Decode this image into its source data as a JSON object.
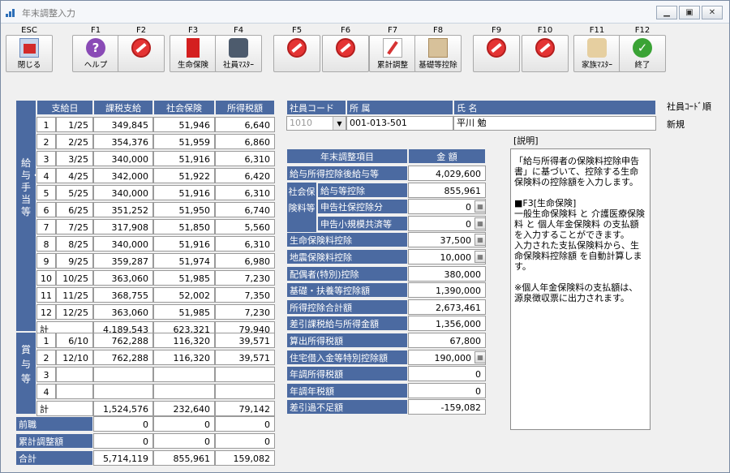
{
  "window": {
    "title": "年末調整入力"
  },
  "toolbar": [
    {
      "key": "ESC",
      "label": "閉じる",
      "icon": "exit-icon"
    },
    {
      "key": "F1",
      "label": "ヘルプ",
      "icon": "help-icon"
    },
    {
      "key": "F2",
      "label": "",
      "icon": "no-entry-icon"
    },
    {
      "key": "F3",
      "label": "生命保険",
      "icon": "life-insurance-icon"
    },
    {
      "key": "F4",
      "label": "社員ﾏｽﾀｰ",
      "icon": "employee-master-icon"
    },
    {
      "key": "F5",
      "label": "",
      "icon": "no-entry-icon"
    },
    {
      "key": "F6",
      "label": "",
      "icon": "no-entry-icon"
    },
    {
      "key": "F7",
      "label": "累計調整",
      "icon": "cumulative-adjust-icon"
    },
    {
      "key": "F8",
      "label": "基礎等控除",
      "icon": "basic-deduction-icon"
    },
    {
      "key": "F9",
      "label": "",
      "icon": "no-entry-icon"
    },
    {
      "key": "F10",
      "label": "",
      "icon": "no-entry-icon"
    },
    {
      "key": "F11",
      "label": "家族ﾏｽﾀｰ",
      "icon": "family-master-icon"
    },
    {
      "key": "F12",
      "label": "終了",
      "icon": "check-icon"
    }
  ],
  "salary": {
    "side_label": "給与・手当等",
    "headers": [
      "支給日",
      "課税支給",
      "社会保険",
      "所得税額"
    ],
    "rows": [
      [
        "1",
        "1/25",
        "349,845",
        "51,946",
        "6,640"
      ],
      [
        "2",
        "2/25",
        "354,376",
        "51,959",
        "6,860"
      ],
      [
        "3",
        "3/25",
        "340,000",
        "51,916",
        "6,310"
      ],
      [
        "4",
        "4/25",
        "342,000",
        "51,922",
        "6,420"
      ],
      [
        "5",
        "5/25",
        "340,000",
        "51,916",
        "6,310"
      ],
      [
        "6",
        "6/25",
        "351,252",
        "51,950",
        "6,740"
      ],
      [
        "7",
        "7/25",
        "317,908",
        "51,850",
        "5,560"
      ],
      [
        "8",
        "8/25",
        "340,000",
        "51,916",
        "6,310"
      ],
      [
        "9",
        "9/25",
        "359,287",
        "51,974",
        "6,980"
      ],
      [
        "10",
        "10/25",
        "363,060",
        "51,985",
        "7,230"
      ],
      [
        "11",
        "11/25",
        "368,755",
        "52,002",
        "7,350"
      ],
      [
        "12",
        "12/25",
        "363,060",
        "51,985",
        "7,230"
      ]
    ],
    "total": [
      "計",
      "4,189,543",
      "623,321",
      "79,940"
    ]
  },
  "bonus": {
    "side_label": "賞与等",
    "rows": [
      [
        "1",
        "6/10",
        "762,288",
        "116,320",
        "39,571"
      ],
      [
        "2",
        "12/10",
        "762,288",
        "116,320",
        "39,571"
      ],
      [
        "3",
        "",
        "",
        "",
        ""
      ],
      [
        "4",
        "",
        "",
        "",
        ""
      ]
    ],
    "total": [
      "計",
      "1,524,576",
      "232,640",
      "79,142"
    ]
  },
  "previous": {
    "label": "前職",
    "values": [
      "0",
      "0",
      "0"
    ]
  },
  "cumulative": {
    "label": "累計調整額",
    "values": [
      "0",
      "0",
      "0"
    ]
  },
  "grand_total": {
    "label": "合計",
    "values": [
      "5,714,119",
      "855,961",
      "159,082"
    ]
  },
  "employee": {
    "code_label": "社員コード",
    "dept_label": "所 属",
    "name_label": "氏 名",
    "code_value": "1010",
    "dept_value": "001-013-501",
    "name_value": "平川 勉",
    "sort_label": "社員ｺｰﾄﾞ順",
    "status": "新規"
  },
  "adjust": {
    "item_header": "年末調整項目",
    "amount_header": "金 額",
    "group_label": "社会保険料等",
    "rows": [
      {
        "label": "給与所得控除後給与等",
        "value": "4,029,600",
        "cal": false,
        "sub": false
      },
      {
        "label": "給与等控除",
        "value": "855,961",
        "cal": false,
        "sub": true
      },
      {
        "label": "申告社保控除分",
        "value": "0",
        "cal": true,
        "sub": true
      },
      {
        "label": "申告小規模共済等",
        "value": "0",
        "cal": true,
        "sub": true
      },
      {
        "label": "生命保険料控除",
        "value": "37,500",
        "cal": true,
        "sub": false
      },
      {
        "label": "地震保険料控除",
        "value": "10,000",
        "cal": true,
        "sub": false
      },
      {
        "label": "配偶者(特別)控除",
        "value": "380,000",
        "cal": false,
        "sub": false
      },
      {
        "label": "基礎・扶養等控除額",
        "value": "1,390,000",
        "cal": false,
        "sub": false
      },
      {
        "label": "所得控除合計額",
        "value": "2,673,461",
        "cal": false,
        "sub": false
      },
      {
        "label": "差引課税給与所得金額",
        "value": "1,356,000",
        "cal": false,
        "sub": false
      },
      {
        "label": "算出所得税額",
        "value": "67,800",
        "cal": false,
        "sub": false
      },
      {
        "label": "住宅借入金等特別控除額",
        "value": "190,000",
        "cal": true,
        "sub": false
      },
      {
        "label": "年調所得税額",
        "value": "0",
        "cal": false,
        "sub": false
      },
      {
        "label": "年調年税額",
        "value": "0",
        "cal": false,
        "sub": false
      },
      {
        "label": "差引過不足額",
        "value": "-159,082",
        "cal": false,
        "sub": false
      }
    ]
  },
  "explanation": {
    "title": "[説明]",
    "body": "「給与所得者の保険料控除申告書」に基づいて、控除する生命保険料の控除額を入力します。\n\n■F3[生命保険]\n一般生命保険料 と 介護医療保険料 と 個人年金保険料 の支払額を入力することができます。\n入力された支払保険料から、生命保険料控除額 を自動計算します。\n\n※個人年金保険料の支払額は、源泉徴収票に出力されます。"
  }
}
